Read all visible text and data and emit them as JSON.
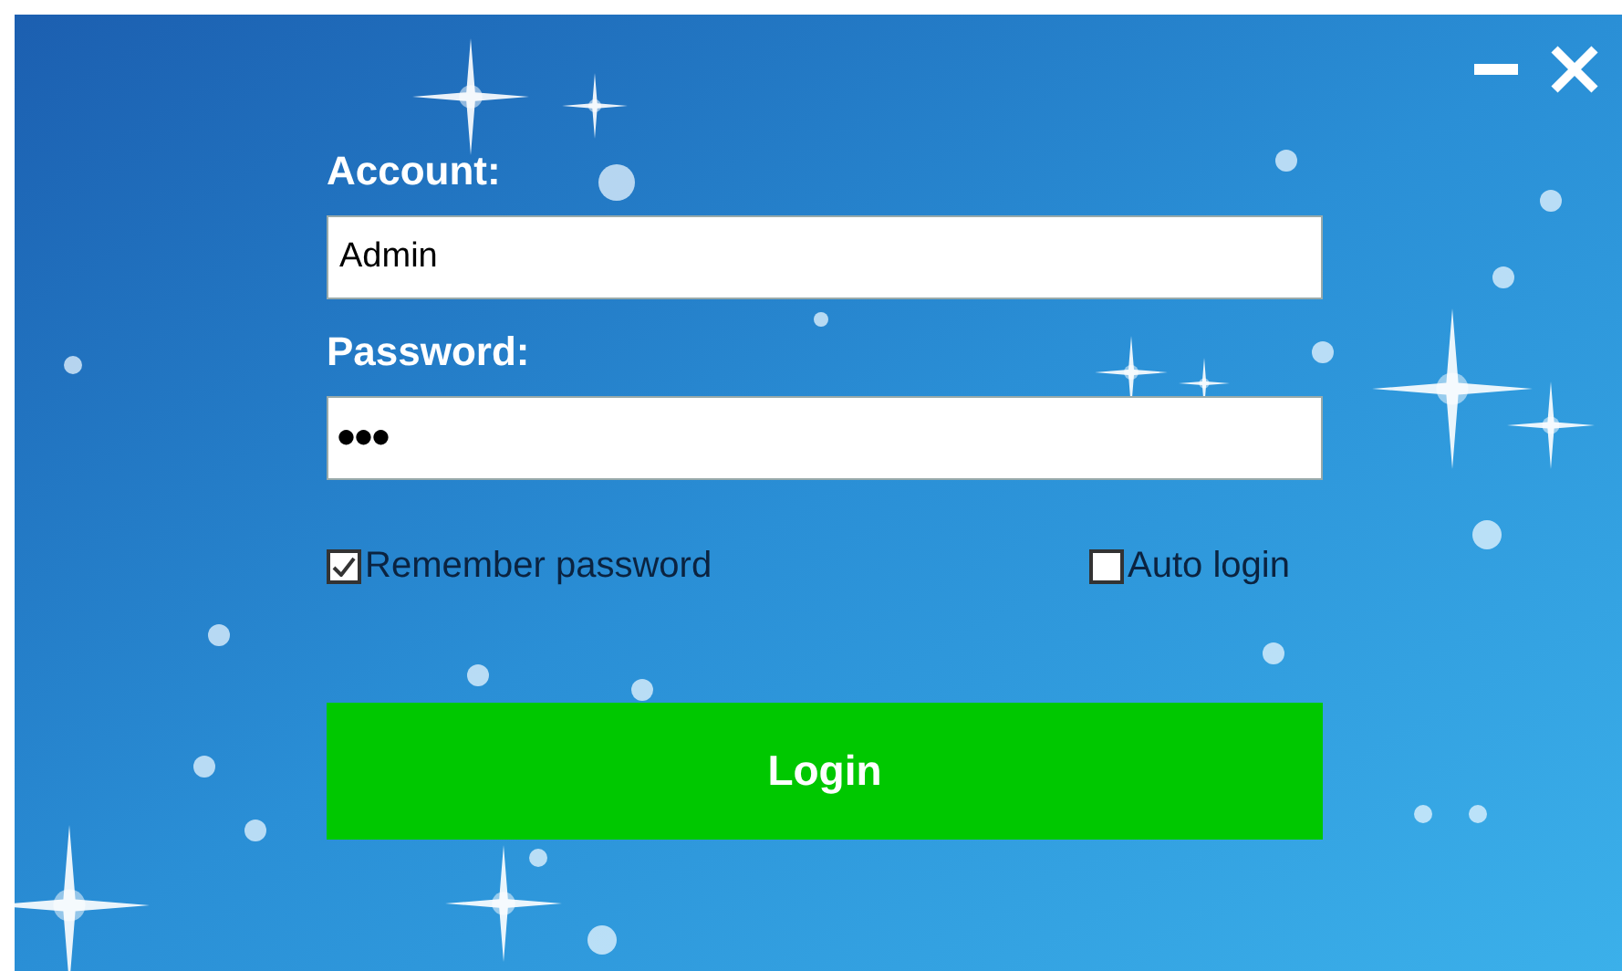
{
  "window": {
    "controls": [
      {
        "kind": "minimize"
      },
      {
        "kind": "close"
      }
    ]
  },
  "account": {
    "label": "Account:",
    "value": "Admin"
  },
  "password": {
    "label": "Password:",
    "value": "●●●"
  },
  "options": [
    {
      "label": "Remember password",
      "checked": true
    },
    {
      "label": "Auto login",
      "checked": false
    }
  ],
  "login_button": {
    "label": "Login"
  }
}
